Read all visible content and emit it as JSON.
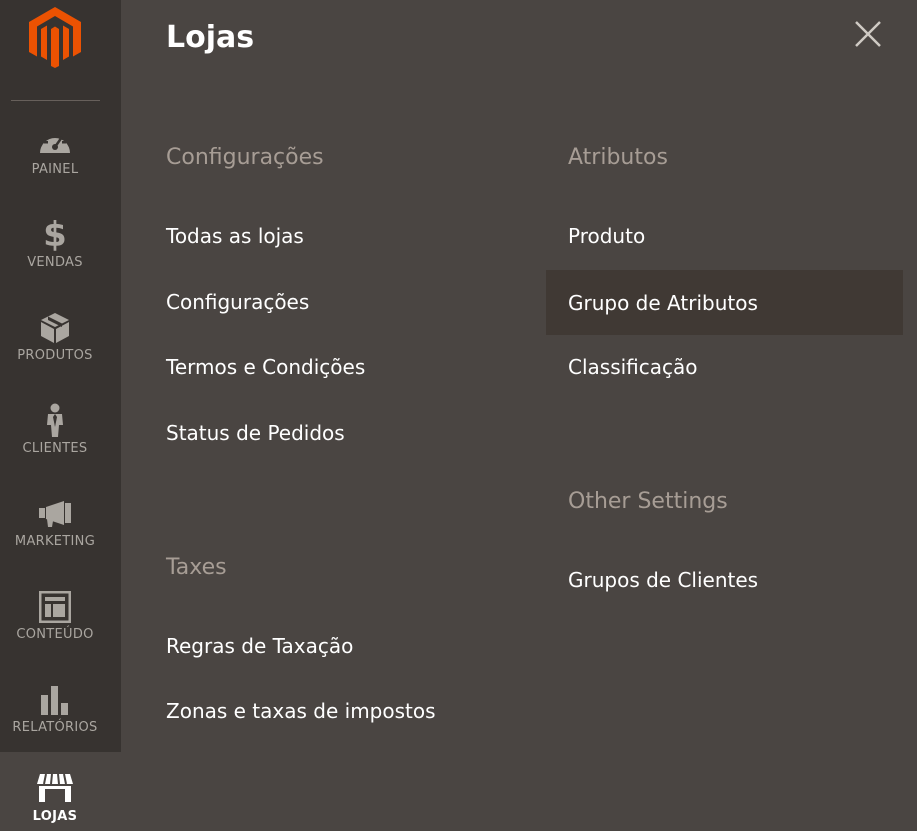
{
  "sidebar": {
    "items": [
      {
        "label": "PAINEL",
        "icon": "dashboard-icon"
      },
      {
        "label": "VENDAS",
        "icon": "dollar-icon"
      },
      {
        "label": "PRODUTOS",
        "icon": "box-icon"
      },
      {
        "label": "CLIENTES",
        "icon": "person-icon"
      },
      {
        "label": "MARKETING",
        "icon": "megaphone-icon"
      },
      {
        "label": "CONTEÚDO",
        "icon": "layout-icon"
      },
      {
        "label": "RELATÓRIOS",
        "icon": "bar-chart-icon"
      },
      {
        "label": "LOJAS",
        "icon": "store-icon"
      }
    ]
  },
  "panel": {
    "title": "Lojas",
    "columns": [
      {
        "sections": [
          {
            "title": "Configurações",
            "links": [
              "Todas as lojas",
              "Configurações",
              "Termos e Condições",
              "Status de Pedidos"
            ]
          },
          {
            "title": "Taxes",
            "links": [
              "Regras de Taxação",
              "Zonas e taxas de impostos"
            ]
          }
        ]
      },
      {
        "sections": [
          {
            "title": "Atributos",
            "links": [
              "Produto",
              "Grupo de Atributos",
              "Classificação"
            ]
          },
          {
            "title": "Other Settings",
            "links": [
              "Grupos de Clientes"
            ]
          }
        ]
      }
    ]
  },
  "colors": {
    "sidebar_bg": "#373330",
    "panel_bg": "#4a4542",
    "accent": "#eb5202",
    "section_title": "#a79d95",
    "hover_row": "#403934"
  }
}
